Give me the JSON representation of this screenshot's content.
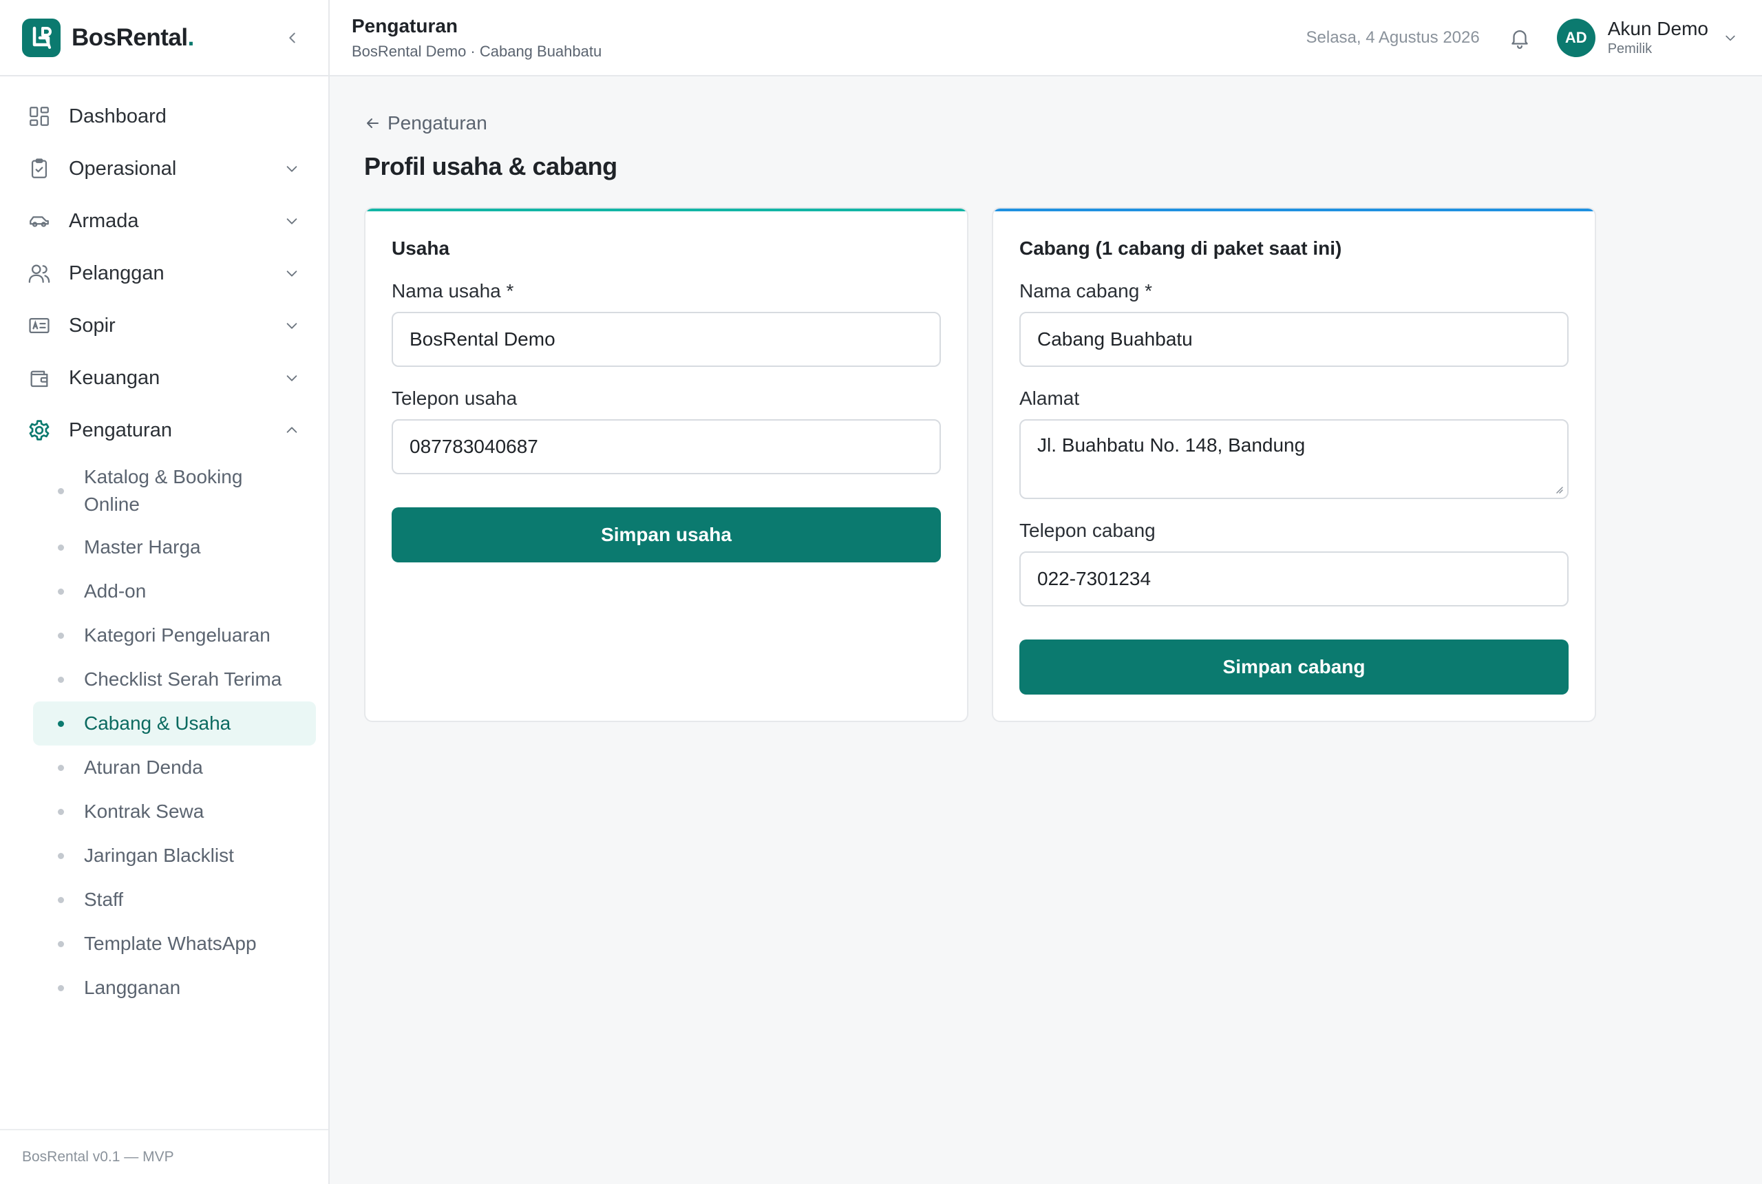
{
  "brand": {
    "name": "BosRental",
    "dot": "."
  },
  "sidebar": {
    "items": [
      {
        "label": "Dashboard"
      },
      {
        "label": "Operasional"
      },
      {
        "label": "Armada"
      },
      {
        "label": "Pelanggan"
      },
      {
        "label": "Sopir"
      },
      {
        "label": "Keuangan"
      },
      {
        "label": "Pengaturan"
      }
    ],
    "subitems": [
      {
        "label": "Katalog & Booking Online"
      },
      {
        "label": "Master Harga"
      },
      {
        "label": "Add-on"
      },
      {
        "label": "Kategori Pengeluaran"
      },
      {
        "label": "Checklist Serah Terima"
      },
      {
        "label": "Cabang & Usaha"
      },
      {
        "label": "Aturan Denda"
      },
      {
        "label": "Kontrak Sewa"
      },
      {
        "label": "Jaringan Blacklist"
      },
      {
        "label": "Staff"
      },
      {
        "label": "Template WhatsApp"
      },
      {
        "label": "Langganan"
      }
    ],
    "footer": "BosRental v0.1 — MVP"
  },
  "header": {
    "title": "Pengaturan",
    "subtitle": "BosRental Demo · Cabang Buahbatu",
    "date": "Selasa, 4 Agustus 2026",
    "user": {
      "initials": "AD",
      "name": "Akun Demo",
      "role": "Pemilik"
    }
  },
  "main": {
    "back": "Pengaturan",
    "title": "Profil usaha & cabang",
    "usaha": {
      "title": "Usaha",
      "name_label": "Nama usaha *",
      "name_value": "BosRental Demo",
      "phone_label": "Telepon usaha",
      "phone_value": "087783040687",
      "save": "Simpan usaha"
    },
    "cabang": {
      "title": "Cabang (1 cabang di paket saat ini)",
      "name_label": "Nama cabang *",
      "name_value": "Cabang Buahbatu",
      "address_label": "Alamat",
      "address_value": "Jl. Buahbatu No. 148, Bandung",
      "phone_label": "Telepon cabang",
      "phone_value": "022-7301234",
      "save": "Simpan cabang"
    }
  },
  "colors": {
    "accent": "#0b7a6f",
    "accent_light": "#eaf7f5",
    "teal_top": "#12b5a5",
    "blue_top": "#1e90e0"
  },
  "icons": [
    "logo-icon",
    "collapse-chevron-icon",
    "dashboard-icon",
    "clipboard-icon",
    "car-icon",
    "users-icon",
    "id-card-icon",
    "wallet-icon",
    "gear-icon",
    "chevron-down-icon",
    "chevron-up-icon",
    "bell-icon",
    "arrow-left-icon"
  ]
}
